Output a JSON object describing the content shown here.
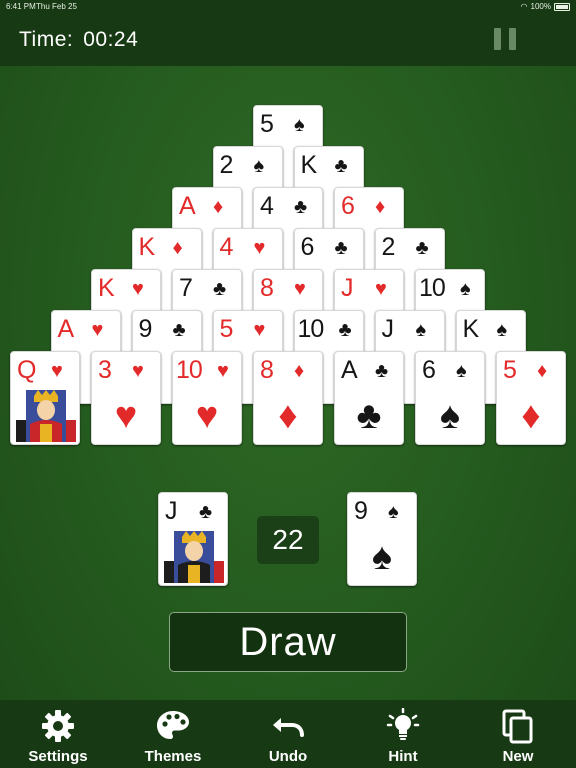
{
  "status_bar": {
    "time": "6:41 PM",
    "date": "Thu Feb 25",
    "battery": "100%"
  },
  "header": {
    "timer_label": "Time:",
    "timer_value": "00:24"
  },
  "pyramid": [
    [
      {
        "rank": "5",
        "suit": "♠",
        "color": "black"
      }
    ],
    [
      {
        "rank": "2",
        "suit": "♠",
        "color": "black"
      },
      {
        "rank": "K",
        "suit": "♣",
        "color": "black"
      }
    ],
    [
      {
        "rank": "A",
        "suit": "♦",
        "color": "red"
      },
      {
        "rank": "4",
        "suit": "♣",
        "color": "black"
      },
      {
        "rank": "6",
        "suit": "♦",
        "color": "red"
      }
    ],
    [
      {
        "rank": "K",
        "suit": "♦",
        "color": "red"
      },
      {
        "rank": "4",
        "suit": "♥",
        "color": "red"
      },
      {
        "rank": "6",
        "suit": "♣",
        "color": "black"
      },
      {
        "rank": "2",
        "suit": "♣",
        "color": "black"
      }
    ],
    [
      {
        "rank": "K",
        "suit": "♥",
        "color": "red"
      },
      {
        "rank": "7",
        "suit": "♣",
        "color": "black"
      },
      {
        "rank": "8",
        "suit": "♥",
        "color": "red"
      },
      {
        "rank": "J",
        "suit": "♥",
        "color": "red"
      },
      {
        "rank": "10",
        "suit": "♠",
        "color": "black"
      }
    ],
    [
      {
        "rank": "A",
        "suit": "♥",
        "color": "red"
      },
      {
        "rank": "9",
        "suit": "♣",
        "color": "black"
      },
      {
        "rank": "5",
        "suit": "♥",
        "color": "red"
      },
      {
        "rank": "10",
        "suit": "♣",
        "color": "black"
      },
      {
        "rank": "J",
        "suit": "♠",
        "color": "black"
      },
      {
        "rank": "K",
        "suit": "♠",
        "color": "black"
      }
    ],
    [
      {
        "rank": "Q",
        "suit": "♥",
        "color": "red",
        "face": true
      },
      {
        "rank": "3",
        "suit": "♥",
        "color": "red"
      },
      {
        "rank": "10",
        "suit": "♥",
        "color": "red"
      },
      {
        "rank": "8",
        "suit": "♦",
        "color": "red"
      },
      {
        "rank": "A",
        "suit": "♣",
        "color": "black"
      },
      {
        "rank": "6",
        "suit": "♠",
        "color": "black"
      },
      {
        "rank": "5",
        "suit": "♦",
        "color": "red"
      }
    ]
  ],
  "stock_card": {
    "rank": "J",
    "suit": "♣",
    "color": "black",
    "face": true
  },
  "stock_count": "22",
  "waste_card": {
    "rank": "9",
    "suit": "♠",
    "color": "black"
  },
  "draw_label": "Draw",
  "toolbar": {
    "settings_label": "Settings",
    "themes_label": "Themes",
    "undo_label": "Undo",
    "hint_label": "Hint",
    "new_label": "New"
  },
  "colors": {
    "felt": "#245a1e",
    "bar": "#173a14",
    "red_suit": "#e32a2a",
    "black_suit": "#161616"
  }
}
